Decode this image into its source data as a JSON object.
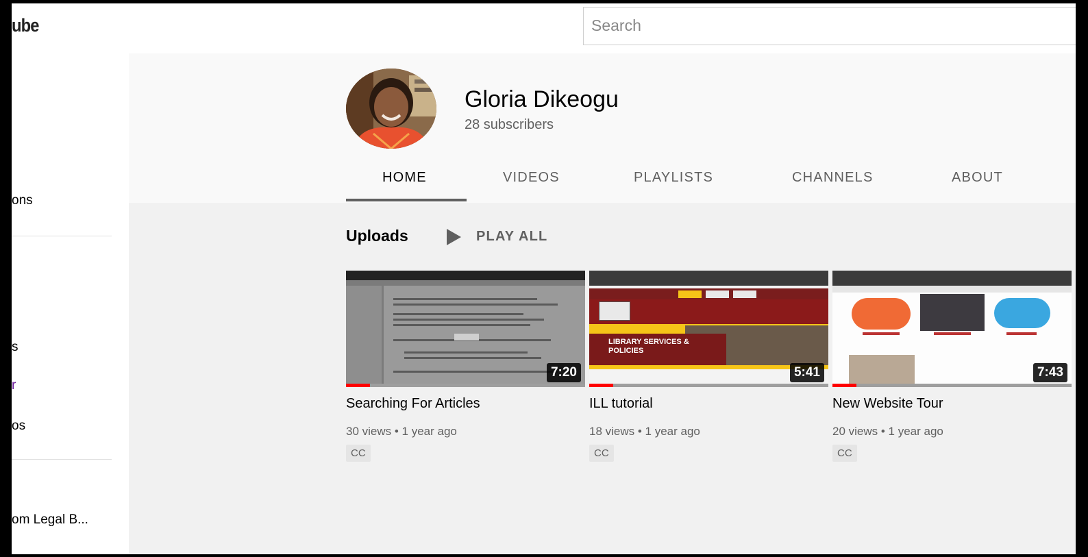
{
  "header": {
    "logo_text": "ube",
    "search_placeholder": "Search"
  },
  "sidebar": {
    "items": [
      {
        "label": "ons"
      },
      {
        "label": "s"
      },
      {
        "label": "r"
      },
      {
        "label": "os"
      },
      {
        "label": "om Legal B..."
      }
    ]
  },
  "channel": {
    "name": "Gloria Dikeogu",
    "subscribers": "28 subscribers",
    "tabs": [
      {
        "label": "HOME",
        "active": true
      },
      {
        "label": "VIDEOS",
        "active": false
      },
      {
        "label": "PLAYLISTS",
        "active": false
      },
      {
        "label": "CHANNELS",
        "active": false
      },
      {
        "label": "ABOUT",
        "active": false
      }
    ]
  },
  "uploads": {
    "title": "Uploads",
    "play_all_label": "PLAY ALL",
    "videos": [
      {
        "title": "Searching For Articles",
        "duration": "7:20",
        "views": "30 views",
        "age": "1 year ago",
        "meta": "30 views • 1 year ago",
        "badge": "CC",
        "watched_fraction": 0.1
      },
      {
        "title": "ILL tutorial",
        "duration": "5:41",
        "views": "18 views",
        "age": "1 year ago",
        "meta": "18 views • 1 year ago",
        "badge": "CC",
        "watched_fraction": 0.1
      },
      {
        "title": "New Website Tour",
        "duration": "7:43",
        "views": "20 views",
        "age": "1 year ago",
        "meta": "20 views • 1 year ago",
        "badge": "CC",
        "watched_fraction": 0.1
      }
    ],
    "thumb2_banner": "LIBRARY SERVICES & POLICIES"
  },
  "colors": {
    "main_bg": "#f1f1f1",
    "header_bg": "#f9f9f9",
    "progress_red": "#ff0000",
    "text_secondary": "#606060"
  }
}
